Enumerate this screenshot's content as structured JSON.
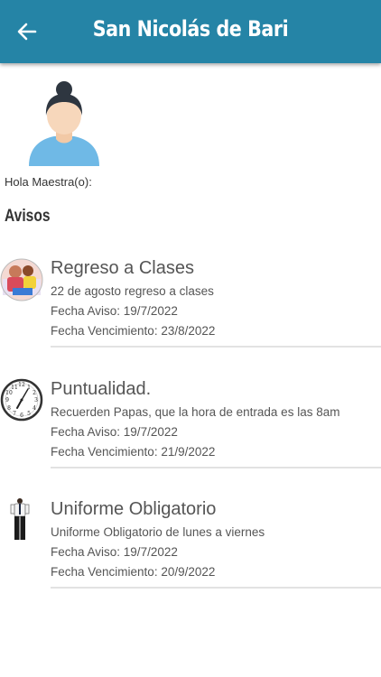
{
  "header": {
    "title": "San Nicolás de Bari",
    "back_icon": "arrow-left-icon"
  },
  "profile": {
    "avatar_icon": "teacher-avatar-icon",
    "greeting": "Hola Maestra(o):"
  },
  "section_title": "Avisos",
  "avisos": [
    {
      "icon": "back-to-school-icon",
      "title": "Regreso a Clases",
      "description": "22 de agosto regreso a clases",
      "fecha_aviso": "Fecha Aviso: 19/7/2022",
      "fecha_vencimiento": "Fecha Vencimiento: 23/8/2022"
    },
    {
      "icon": "clock-icon",
      "title": "Puntualidad.",
      "description": "Recuerden Papas, que la hora de entrada es las 8am",
      "fecha_aviso": "Fecha Aviso: 19/7/2022",
      "fecha_vencimiento": "Fecha Vencimiento: 21/9/2022"
    },
    {
      "icon": "uniform-icon",
      "title": "Uniforme Obligatorio",
      "description": "Uniforme Obligatorio de lunes a viernes",
      "fecha_aviso": "Fecha Aviso: 19/7/2022",
      "fecha_vencimiento": "Fecha Vencimiento: 20/9/2022"
    }
  ],
  "colors": {
    "appbar": "#2584a6",
    "avatar_shirt": "#6fb9e6",
    "divider": "#e2e2e2"
  }
}
